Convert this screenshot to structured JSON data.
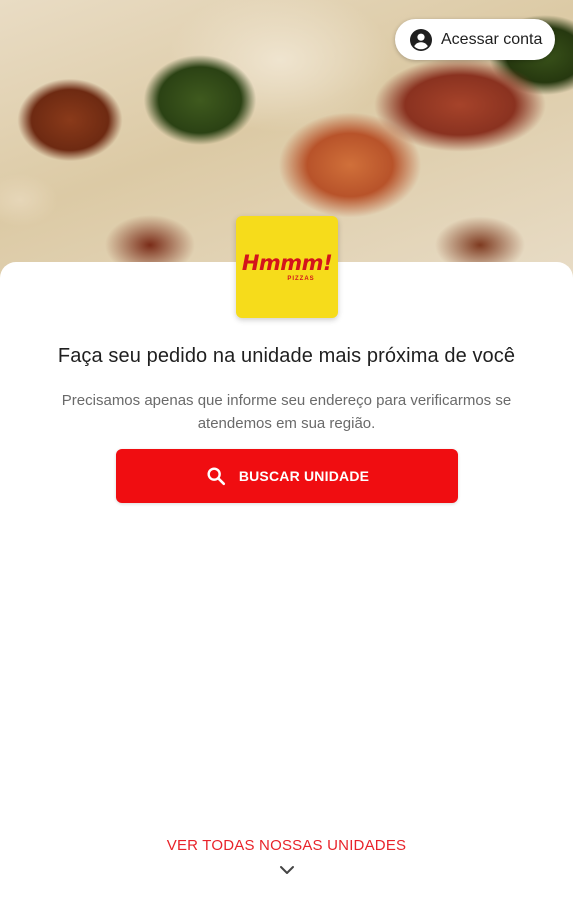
{
  "header": {
    "account_button": {
      "label": "Acessar conta",
      "icon": "account-circle-icon"
    }
  },
  "brand": {
    "logo_text": "Hmmm!",
    "logo_subtext": "PIZZAS",
    "logo_background": "#f6dc1b",
    "logo_color": "#d3141c"
  },
  "main": {
    "headline": "Faça seu pedido na unidade mais próxima de você",
    "subtext": "Precisamos apenas que informe seu endereço para verificarmos se atendemos em sua região.",
    "search_button": {
      "label": "BUSCAR UNIDADE",
      "icon": "search-icon",
      "color": "#f00d11"
    }
  },
  "footer": {
    "see_all_link": "VER TODAS NOSSAS UNIDADES",
    "expand_icon": "chevron-down-icon",
    "link_color": "#e8232a"
  }
}
